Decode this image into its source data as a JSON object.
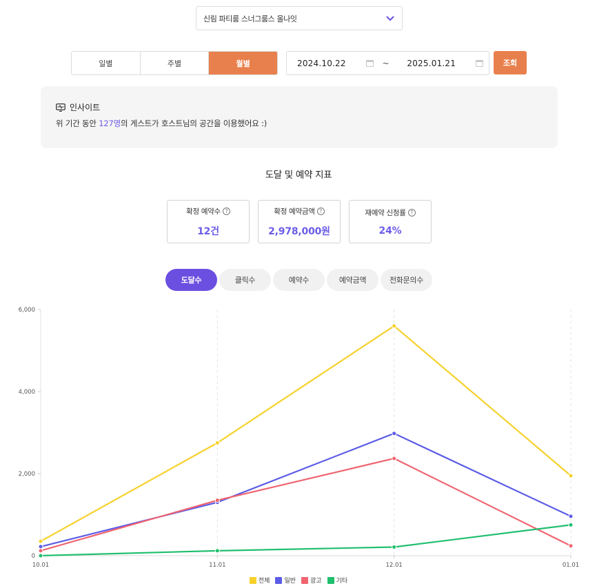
{
  "space_select": {
    "value": "신림 파티룸 스너그룸스 올나잇"
  },
  "period_tabs": [
    {
      "label": "일별",
      "active": false
    },
    {
      "label": "주별",
      "active": false
    },
    {
      "label": "월별",
      "active": true
    }
  ],
  "date_range": {
    "start": "2024.10.22",
    "separator": "~",
    "end": "2025.01.21"
  },
  "search_button": "조회",
  "insight": {
    "title": "인사이트",
    "message_prefix": "위 기간 동안 ",
    "message_highlight": "127명",
    "message_suffix": "의 게스트가 호스트님의 공간을 이용했어요 :)"
  },
  "metric_title": "도달 및 예약 지표",
  "kpis": [
    {
      "label": "확정 예약수",
      "value": "12건"
    },
    {
      "label": "확정 예약금액",
      "value": "2,978,000원"
    },
    {
      "label": "재예약 신청률",
      "value": "24%"
    }
  ],
  "chart_tabs": [
    {
      "label": "도달수",
      "active": true
    },
    {
      "label": "클릭수",
      "active": false
    },
    {
      "label": "예약수",
      "active": false
    },
    {
      "label": "예약금액",
      "active": false
    },
    {
      "label": "전화문의수",
      "active": false
    }
  ],
  "chart_data": {
    "type": "line",
    "x": [
      "10.01",
      "11.01",
      "12.01",
      "01.01"
    ],
    "ylim": [
      0,
      6000
    ],
    "yticks": [
      "0",
      "2,000",
      "4,000",
      "6,000"
    ],
    "ytick_values": [
      0,
      2000,
      4000,
      6000
    ],
    "grid": "vertical-dashed",
    "legend_position": "bottom",
    "series": [
      {
        "name": "전체",
        "color": "#f6d12b",
        "values": [
          350,
          2750,
          5600,
          1950
        ]
      },
      {
        "name": "일반",
        "color": "#5b5ce6",
        "values": [
          220,
          1300,
          2980,
          960
        ]
      },
      {
        "name": "광고",
        "color": "#ef6470",
        "values": [
          120,
          1350,
          2370,
          240
        ]
      },
      {
        "name": "기타",
        "color": "#1fbf6e",
        "values": [
          0,
          120,
          210,
          750
        ]
      }
    ]
  }
}
